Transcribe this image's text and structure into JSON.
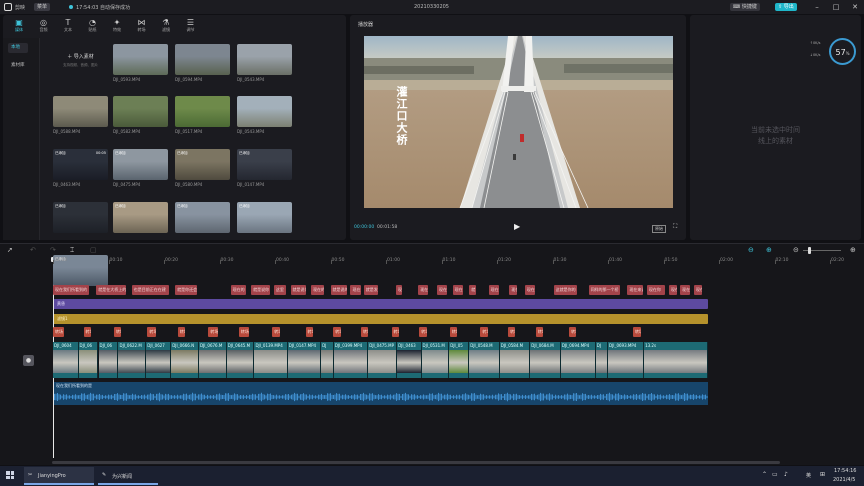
{
  "titlebar": {
    "app_name": "剪映",
    "menu_label": "菜单",
    "save_status": "17:54:03 自动保存成功",
    "project_name": "20210330205",
    "shortcut_label": "快捷键",
    "export_label": "导出",
    "minimize": "–",
    "maximize": "□",
    "close": "✕"
  },
  "toolbar": {
    "items": [
      {
        "label": "媒体",
        "icon": "media-icon",
        "glyph": "▣"
      },
      {
        "label": "音频",
        "icon": "audio-icon",
        "glyph": "◎"
      },
      {
        "label": "文本",
        "icon": "text-icon",
        "glyph": "T"
      },
      {
        "label": "贴纸",
        "icon": "sticker-icon",
        "glyph": "◔"
      },
      {
        "label": "特效",
        "icon": "effects-icon",
        "glyph": "✦"
      },
      {
        "label": "转场",
        "icon": "transition-icon",
        "glyph": "⋈"
      },
      {
        "label": "滤镜",
        "icon": "filter-icon",
        "glyph": "⚗"
      },
      {
        "label": "调节",
        "icon": "adjust-icon",
        "glyph": "☰"
      }
    ]
  },
  "media_sidebar": {
    "items": [
      "本地",
      "素材库"
    ]
  },
  "import": {
    "label": "导入素材",
    "hint": "支持视频、音频、图片"
  },
  "media_grid": [
    {
      "name": "DJI_0593.MP4",
      "badge": "",
      "dur": ""
    },
    {
      "name": "DJI_0594.MP4",
      "badge": "",
      "dur": ""
    },
    {
      "name": "DJI_0543.MP4",
      "badge": "",
      "dur": ""
    },
    {
      "name": "DJI_0588.MP4",
      "badge": "",
      "dur": ""
    },
    {
      "name": "DJI_0582.MP4",
      "badge": "",
      "dur": ""
    },
    {
      "name": "DJI_0517.MP4",
      "badge": "",
      "dur": ""
    },
    {
      "name": "DJI_0543.MP4",
      "badge": "",
      "dur": ""
    },
    {
      "name": "DJI_0463.MP4",
      "badge": "已添加",
      "dur": "00:05"
    },
    {
      "name": "DJI_0475.MP4",
      "badge": "已添加",
      "dur": ""
    },
    {
      "name": "DJI_0580.MP4",
      "badge": "已添加",
      "dur": ""
    },
    {
      "name": "DJI_0147.MP4",
      "badge": "已添加",
      "dur": ""
    },
    {
      "name": "",
      "badge": "已添加",
      "dur": ""
    },
    {
      "name": "",
      "badge": "已添加",
      "dur": ""
    },
    {
      "name": "",
      "badge": "已添加",
      "dur": ""
    },
    {
      "name": "",
      "badge": "已添加",
      "dur": ""
    },
    {
      "name": "",
      "badge": "已添加",
      "dur": ""
    }
  ],
  "player": {
    "title": "播放器",
    "overlay_text": "灌江口大桥",
    "time_current": "00:00:00",
    "time_total": "00:01:58",
    "ratio_label": "原始"
  },
  "properties": {
    "empty_text_line1": "当前未选中时间",
    "empty_text_line2": "线上的素材",
    "cpu_percent": "57",
    "net_up": "0K/s",
    "net_down": "0K/s"
  },
  "timeline": {
    "ruler": [
      "00:00",
      "00:10",
      "00:20",
      "00:30",
      "00:40",
      "00:50",
      "01:00",
      "01:10",
      "01:20",
      "01:30",
      "01:40",
      "01:50",
      "02:00",
      "02:10",
      "02:20"
    ],
    "text_clips": [
      {
        "label": "现在我们所看到的",
        "start": 0,
        "dur": 6.7
      },
      {
        "label": "就是在大桥上的",
        "start": 7.8,
        "dur": 5.5
      },
      {
        "label": "也是目前正在在建",
        "start": 14.2,
        "dur": 6.8
      },
      {
        "label": "就是你还会天",
        "start": 22.0,
        "dur": 4.2
      },
      {
        "label": "现在的",
        "start": 32.0,
        "dur": 2.9
      },
      {
        "label": "就是说你",
        "start": 35.7,
        "dur": 3.6
      },
      {
        "label": "这里",
        "start": 39.8,
        "dur": 2.4
      },
      {
        "label": "就是说你",
        "start": 42.8,
        "dur": 3.0
      },
      {
        "label": "现在的",
        "start": 46.5,
        "dur": 2.6
      },
      {
        "label": "就是说的",
        "start": 50.0,
        "dur": 3.2
      },
      {
        "label": "现在",
        "start": 53.6,
        "dur": 2.0
      },
      {
        "label": "就是发达",
        "start": 56.0,
        "dur": 2.8
      },
      {
        "label": "现",
        "start": 61.8,
        "dur": 1.3
      },
      {
        "label": "现在",
        "start": 65.8,
        "dur": 2.0
      },
      {
        "label": "现在",
        "start": 69.2,
        "dur": 2.0
      },
      {
        "label": "现在",
        "start": 72.0,
        "dur": 2.0
      },
      {
        "label": "就",
        "start": 75.0,
        "dur": 1.4
      },
      {
        "label": "现在",
        "start": 78.5,
        "dur": 2.0
      },
      {
        "label": "现在",
        "start": 82.2,
        "dur": 1.6
      },
      {
        "label": "现在",
        "start": 85.0,
        "dur": 2.0
      },
      {
        "label": "这就是你的",
        "start": 90.2,
        "dur": 4.4
      },
      {
        "label": "同样的那一个桥",
        "start": 96.5,
        "dur": 5.8
      },
      {
        "label": "现在来说",
        "start": 103.5,
        "dur": 3.0
      },
      {
        "label": "现在你",
        "start": 107.0,
        "dur": 3.4
      },
      {
        "label": "现在",
        "start": 111.0,
        "dur": 1.6
      },
      {
        "label": "现在",
        "start": 113.0,
        "dur": 2.0
      },
      {
        "label": "现在",
        "start": 115.5,
        "dur": 1.6
      }
    ],
    "purple_track": {
      "label": "黄昏",
      "start": 0,
      "dur": 118.0
    },
    "gold_track": {
      "label": "滤镜1",
      "start": 0,
      "dur": 118.0
    },
    "effect_clips": [
      {
        "label": "转场",
        "start": 0,
        "dur": 2.2
      },
      {
        "label": "转场",
        "start": 5.5,
        "dur": 1.5
      },
      {
        "label": "转场",
        "start": 11.0,
        "dur": 1.5
      },
      {
        "label": "转场",
        "start": 17.0,
        "dur": 1.8
      },
      {
        "label": "转场",
        "start": 22.5,
        "dur": 1.5
      },
      {
        "label": "转场",
        "start": 28.0,
        "dur": 2.0
      },
      {
        "label": "转场",
        "start": 33.5,
        "dur": 2.0
      },
      {
        "label": "转场",
        "start": 39.5,
        "dur": 1.5
      },
      {
        "label": "转场",
        "start": 45.5,
        "dur": 1.5
      },
      {
        "label": "转场",
        "start": 50.5,
        "dur": 1.5
      },
      {
        "label": "转场",
        "start": 55.5,
        "dur": 1.5
      },
      {
        "label": "转场",
        "start": 61.0,
        "dur": 1.5
      },
      {
        "label": "转场",
        "start": 66.0,
        "dur": 1.5
      },
      {
        "label": "转场",
        "start": 71.5,
        "dur": 1.5
      },
      {
        "label": "转场",
        "start": 77.0,
        "dur": 1.5
      },
      {
        "label": "转场",
        "start": 82.0,
        "dur": 1.5
      },
      {
        "label": "转场",
        "start": 87.0,
        "dur": 1.5
      },
      {
        "label": "转场",
        "start": 93.0,
        "dur": 1.5
      },
      {
        "label": "转场",
        "start": 104.5,
        "dur": 1.6
      }
    ],
    "video_clips": [
      {
        "label": "DJI_0604",
        "start": 0,
        "dur": 4.6,
        "color": "#6b7a82"
      },
      {
        "label": "DJI_06",
        "start": 4.6,
        "dur": 3.6,
        "color": "#8a8f7a"
      },
      {
        "label": "DJI_06",
        "start": 8.2,
        "dur": 3.6,
        "color": "#555d66"
      },
      {
        "label": "DJI_0622.M",
        "start": 11.8,
        "dur": 5.0,
        "color": "#3f4a52"
      },
      {
        "label": "DJI_0627",
        "start": 16.8,
        "dur": 4.5,
        "color": "#2e3a44"
      },
      {
        "label": "DJI_0666.N",
        "start": 21.3,
        "dur": 5.0,
        "color": "#7c7a62"
      },
      {
        "label": "DJI_0676.M",
        "start": 26.3,
        "dur": 5.0,
        "color": "#6e6f70"
      },
      {
        "label": "DJI_0645.M",
        "start": 31.3,
        "dur": 5.0,
        "color": "#595f63"
      },
      {
        "label": "DJI_0139.MP4",
        "start": 36.3,
        "dur": 6.0,
        "color": "#8b8c88"
      },
      {
        "label": "DJI_0147.MP4",
        "start": 42.3,
        "dur": 6.0,
        "color": "#5f6972"
      },
      {
        "label": "DJ",
        "start": 48.3,
        "dur": 2.3,
        "color": "#7a7b77"
      },
      {
        "label": "DJI_0399.MP4",
        "start": 50.6,
        "dur": 6.2,
        "color": "#70747a"
      },
      {
        "label": "DJI_0475.MP",
        "start": 56.8,
        "dur": 5.2,
        "color": "#8d8e8a"
      },
      {
        "label": "DJI_0463",
        "start": 62.0,
        "dur": 4.4,
        "color": "#1c2230"
      },
      {
        "label": "DJI_0531.M",
        "start": 66.4,
        "dur": 5.0,
        "color": "#7e8a8c"
      },
      {
        "label": "DJI_05",
        "start": 71.4,
        "dur": 3.6,
        "color": "#5f8a3c"
      },
      {
        "label": "DJI_0548.M",
        "start": 75.0,
        "dur": 5.5,
        "color": "#6f7e86"
      },
      {
        "label": "DJI_0584.M",
        "start": 80.5,
        "dur": 5.5,
        "color": "#8e8f8a"
      },
      {
        "label": "DJI_0684.M",
        "start": 86.0,
        "dur": 5.5,
        "color": "#6d7275"
      },
      {
        "label": "DJI_0694.MP4",
        "start": 91.5,
        "dur": 6.3,
        "color": "#7e8184"
      },
      {
        "label": "DJ",
        "start": 97.8,
        "dur": 2.2,
        "color": "#6a6f73"
      },
      {
        "label": "DJI_0693.MP4",
        "start": 100.0,
        "dur": 6.5,
        "color": "#6f757b"
      },
      {
        "label": "13.2s",
        "start": 106.5,
        "dur": 11.5,
        "color": "#767b80"
      }
    ],
    "audio_track": {
      "label": "现在我们所看到的是",
      "start": 0,
      "dur": 118.0
    }
  },
  "taskbar": {
    "items": [
      {
        "label": "JianyingPro",
        "icon": "jianying-icon"
      },
      {
        "label": "为兴新闻",
        "icon": "app-icon"
      }
    ],
    "language": "英",
    "time": "17:54:16",
    "date": "2021/4/5"
  }
}
